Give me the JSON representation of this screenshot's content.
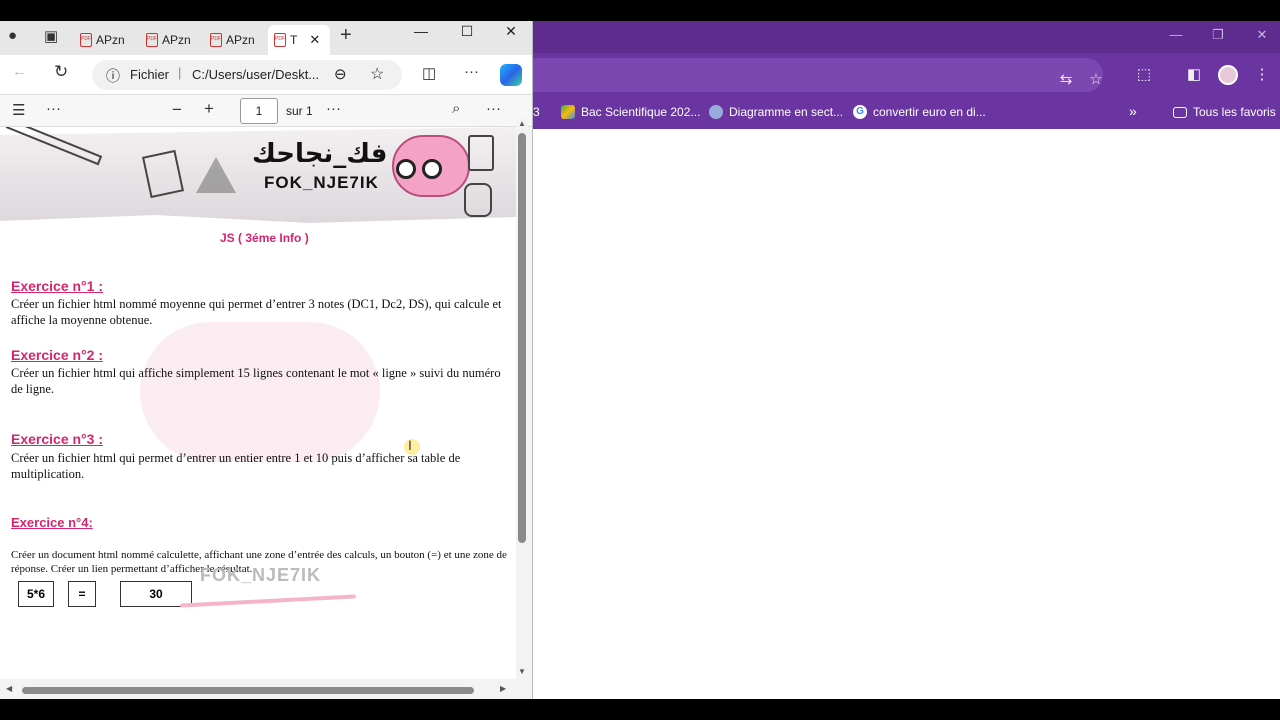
{
  "left_window": {
    "tabs": [
      {
        "label": "APzn"
      },
      {
        "label": "APzn"
      },
      {
        "label": "APzn"
      },
      {
        "label": "T"
      }
    ],
    "address": {
      "scheme": "Fichier",
      "url": "C:/Users/user/Deskt..."
    },
    "pdf_toolbar": {
      "page_value": "1",
      "page_total": "sur 1"
    }
  },
  "document": {
    "logo_ar": "فك_نجاحك",
    "logo_en": "FOK_NJE7IK",
    "title": "JS ( 3éme Info )",
    "exercises": [
      {
        "heading": "Exercice n°1 :",
        "text": "Créer un fichier html nommé moyenne qui permet d’entrer 3 notes (DC1, Dc2, DS), qui calcule et affiche la moyenne obtenue."
      },
      {
        "heading": "Exercice n°2 :",
        "text": "Créer un fichier html qui affiche simplement 15 lignes contenant le mot « ligne » suivi du numéro de ligne."
      },
      {
        "heading": "Exercice n°3 :",
        "text": "Créer un fichier html qui permet d’entrer un entier entre 1 et 10 puis d’afficher sa table de multiplication."
      },
      {
        "heading": "Exercice n°4:",
        "text": "Créer un document html nommé calculette, affichant une zone d’entrée des calculs, un bouton (=) et une zone de réponse. Créer un lien permettant d’afficher le résultat."
      }
    ],
    "calc": {
      "input": "5*6",
      "button": "=",
      "result": "30"
    },
    "watermark": "FOK_NJE7IK"
  },
  "right_window": {
    "bookmarks": [
      {
        "label": "3"
      },
      {
        "label": "Bac Scientifique 202..."
      },
      {
        "label": "Diagramme en sect..."
      },
      {
        "label": "convertir euro en di..."
      },
      {
        "label": "»"
      },
      {
        "label": "Tous les favoris"
      }
    ]
  },
  "colors": {
    "accent_pink": "#d6246e",
    "chrome_purple": "#6b35a1"
  }
}
